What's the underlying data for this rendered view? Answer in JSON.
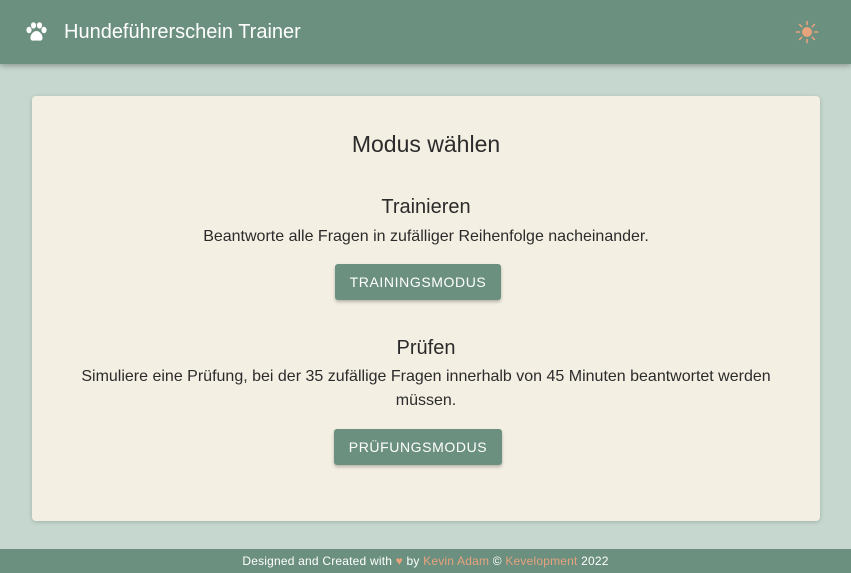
{
  "header": {
    "title": "Hundeführerschein Trainer",
    "logo_icon": "paw-icon",
    "theme_icon": "sun-icon",
    "background": "#6b9080"
  },
  "card": {
    "title": "Modus wählen",
    "training": {
      "title": "Trainieren",
      "description": "Beantworte alle Fragen in zufälliger Reihenfolge nacheinander.",
      "button_label": "TRAININGSMODUS"
    },
    "exam": {
      "title": "Prüfen",
      "description": "Simuliere eine Prüfung, bei der 35 zufällige Fragen innerhalb von 45 Minuten beantwortet werden müssen.",
      "button_label": "PRÜFUNGSMODUS"
    }
  },
  "footer": {
    "prefix": "Designed and Created with",
    "heart": "♥",
    "by": "by",
    "author": "Kevin Adam",
    "copyright": "©",
    "company": "Kevelopment",
    "year": "2022",
    "accent": "#e8a27c"
  }
}
